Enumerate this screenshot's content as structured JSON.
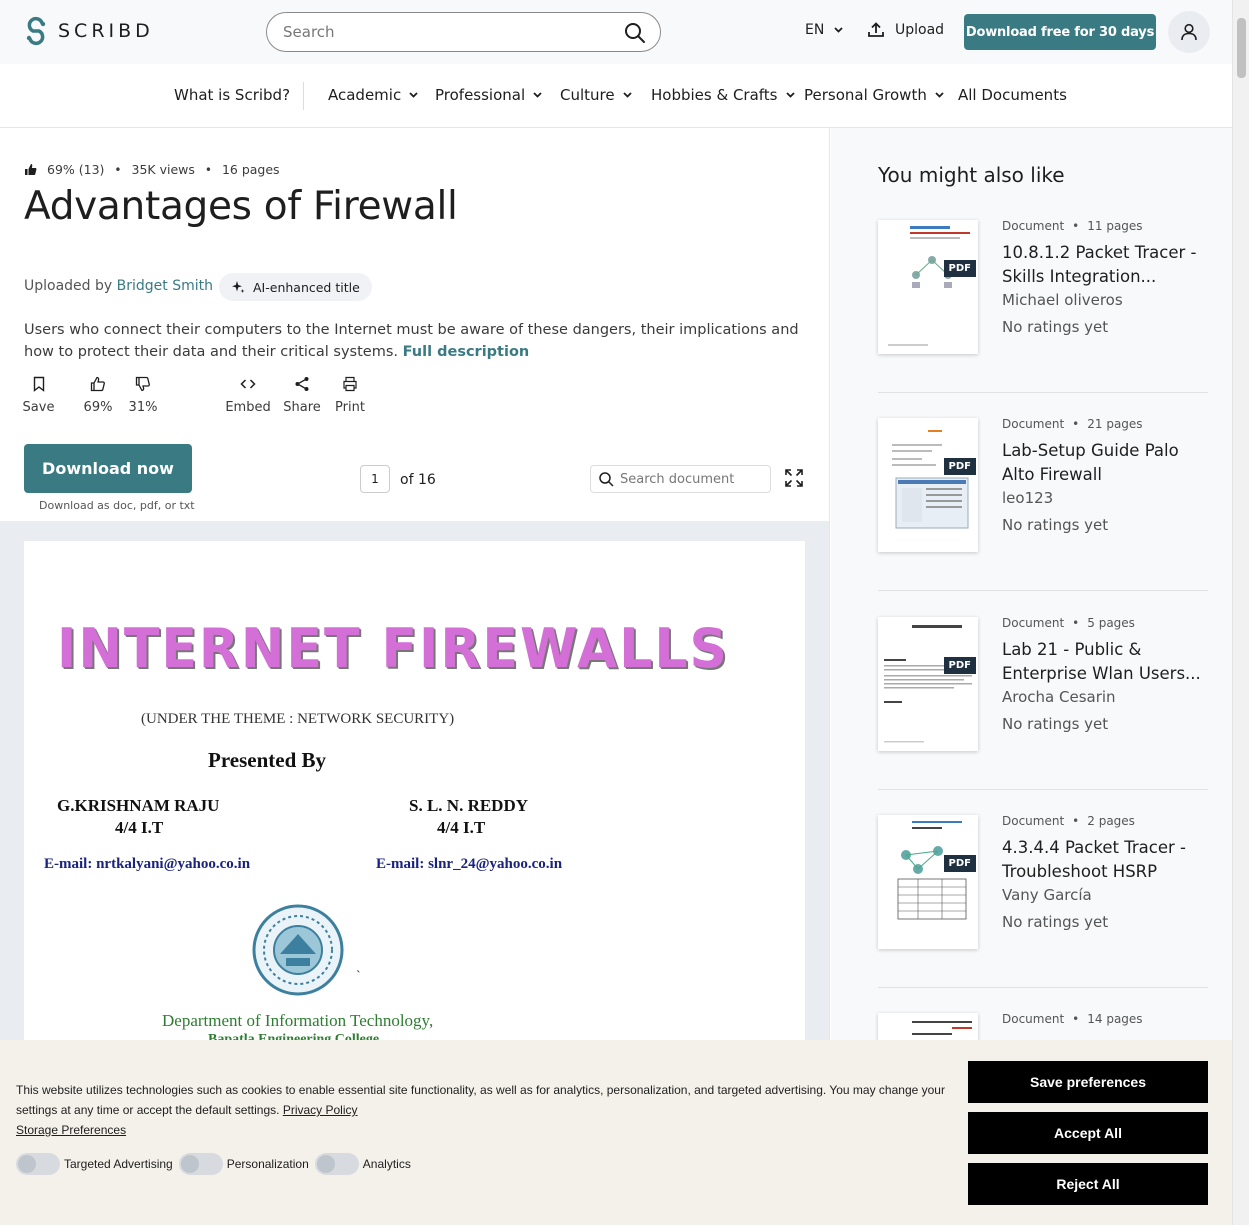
{
  "header": {
    "logo_text": "SCRIBD",
    "search_placeholder": "Search",
    "language": "EN",
    "upload_label": "Upload",
    "download_free_label": "Download free for 30 days"
  },
  "nav": {
    "items": [
      "What is Scribd?",
      "Academic",
      "Professional",
      "Culture",
      "Hobbies & Crafts",
      "Personal Growth",
      "All Documents"
    ]
  },
  "document": {
    "rating": "69% (13)",
    "views": "35K views",
    "pages": "16 pages",
    "title": "Advantages of Firewall",
    "uploaded_by_label": "Uploaded by",
    "uploader": "Bridget Smith",
    "ai_label": "AI-enhanced title",
    "description": "Users who connect their computers to the Internet must be aware of these dangers, their implications and how to protect their data and their critical systems.",
    "full_description_label": "Full description",
    "actions": [
      {
        "label": "Save",
        "icon": "bookmark-icon"
      },
      {
        "label": "69%",
        "icon": "thumbs-up-icon"
      },
      {
        "label": "31%",
        "icon": "thumbs-down-icon"
      },
      {
        "label": "Embed",
        "icon": "code-icon"
      },
      {
        "label": "Share",
        "icon": "share-icon"
      },
      {
        "label": "Print",
        "icon": "printer-icon"
      }
    ],
    "download_now_label": "Download now",
    "download_sub": "Download as doc, pdf, or txt",
    "current_page": "1",
    "of_pages": "of 16",
    "search_document_placeholder": "Search document"
  },
  "pdf_page": {
    "heading": "INTERNET FIREWALLS",
    "theme": "(UNDER THE THEME : NETWORK SECURITY)",
    "presented_by": "Presented  By",
    "author1_name": "G.KRISHNAM RAJU",
    "author1_class": "4/4 I.T",
    "author2_name": "S. L. N. REDDY",
    "author2_class": "4/4 I.T",
    "author1_email": "E-mail: nrtkalyani@yahoo.co.in",
    "author2_email": "E-mail: slnr_24@yahoo.co.in",
    "tick": "`",
    "department": "Department of  Information Technology,",
    "college": "Bapatla Engineering College"
  },
  "sidebar": {
    "title": "You might also like",
    "items": [
      {
        "type": "Document",
        "pages": "11 pages",
        "title": "10.8.1.2 Packet Tracer - Skills Integration...",
        "author": "Michael oliveros",
        "rating": "No ratings yet",
        "badge": "PDF"
      },
      {
        "type": "Document",
        "pages": "21 pages",
        "title": "Lab-Setup Guide Palo Alto Firewall",
        "author": "leo123",
        "rating": "No ratings yet",
        "badge": "PDF"
      },
      {
        "type": "Document",
        "pages": "5 pages",
        "title": "Lab 21 - Public & Enterprise Wlan Users...",
        "author": "Arocha Cesarin",
        "rating": "No ratings yet",
        "badge": "PDF"
      },
      {
        "type": "Document",
        "pages": "2 pages",
        "title": "4.3.4.4 Packet Tracer - Troubleshoot HSRP",
        "author": "Vany García",
        "rating": "No ratings yet",
        "badge": "PDF"
      },
      {
        "type": "Document",
        "pages": "14 pages",
        "title": "",
        "author": "",
        "rating": "",
        "badge": ""
      }
    ]
  },
  "cookie": {
    "text": "This website utilizes technologies such as cookies to enable essential site functionality, as well as for analytics, personalization, and targeted advertising. You may change your settings at any time or accept the default settings.",
    "privacy_label": "Privacy Policy",
    "storage_label": "Storage Preferences",
    "toggles": [
      "Targeted Advertising",
      "Personalization",
      "Analytics"
    ],
    "save_label": "Save preferences",
    "accept_label": "Accept All",
    "reject_label": "Reject All"
  },
  "colors": {
    "brand_teal": "#3a7a83",
    "pdf_title_magenta": "#d36fd6",
    "pdf_email_blue": "#1a237e",
    "pdf_dept_green": "#2e7d32"
  }
}
